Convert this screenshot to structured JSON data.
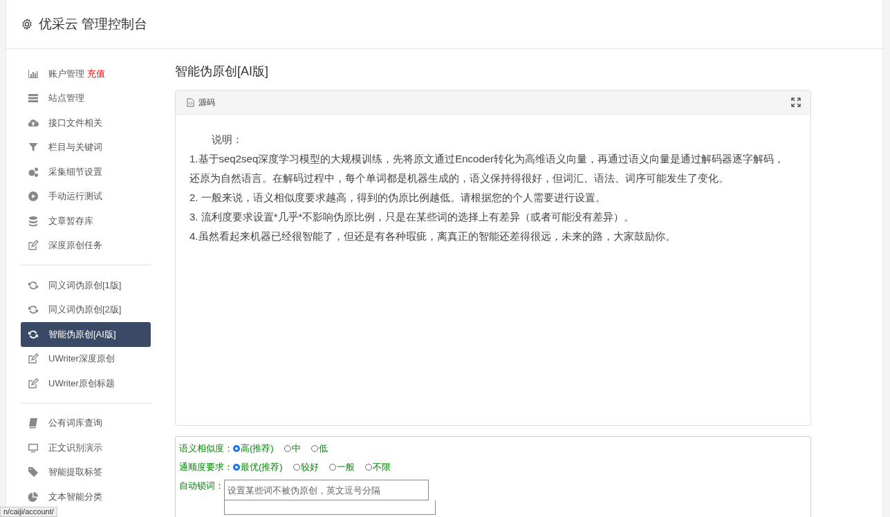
{
  "header": {
    "title": "优采云 管理控制台"
  },
  "sidebar": {
    "groups": [
      {
        "items": [
          {
            "label": "账户管理",
            "badge": "充值",
            "selected": false
          },
          {
            "label": "站点管理",
            "selected": false
          },
          {
            "label": "接口文件相关",
            "selected": false
          },
          {
            "label": "栏目与关键词",
            "selected": false
          },
          {
            "label": "采集细节设置",
            "selected": false
          },
          {
            "label": "手动运行测试",
            "selected": false
          },
          {
            "label": "文章暂存库",
            "selected": false
          },
          {
            "label": "深度原创任务",
            "selected": false
          }
        ]
      },
      {
        "items": [
          {
            "label": "同义词伪原创[1版]",
            "selected": false
          },
          {
            "label": "同义词伪原创[2版]",
            "selected": false
          },
          {
            "label": "智能伪原创[AI版]",
            "selected": true
          },
          {
            "label": "UWriter深度原创",
            "selected": false
          },
          {
            "label": "UWriter原创标题",
            "selected": false
          }
        ]
      },
      {
        "items": [
          {
            "label": "公有词库查询",
            "selected": false
          },
          {
            "label": "正文识别演示",
            "selected": false
          },
          {
            "label": "智能提取标签",
            "selected": false
          },
          {
            "label": "文本智能分类",
            "selected": false
          }
        ]
      }
    ]
  },
  "main": {
    "title": "智能伪原创[AI版]",
    "editor": {
      "tab": "源码",
      "lines": [
        "说明：",
        "1.基于seq2seq深度学习模型的大规模训练，先将原文通过Encoder转化为高维语义向量，再通过语义向量是通过解码器逐字解码，还原为自然语言。在解码过程中，每个单词都是机器生成的，语义保持得很好，但词汇、语法、词序可能发生了变化。",
        "2. 一般来说，语义相似度要求越高，得到的伪原比例越低。请根据您的个人需要进行设置。",
        "3. 流利度要求设置*几乎*不影响伪原比例，只是在某些词的选择上有差异（或者可能没有差异）。",
        "4.虽然看起来机器已经很智能了，但还是有各种瑕疵，离真正的智能还差得很远，未来的路，大家鼓励你。"
      ]
    },
    "options": [
      {
        "label": "语义相似度：",
        "choices": [
          {
            "label": "高(推荐)",
            "selected": true
          },
          {
            "label": "中",
            "selected": false
          },
          {
            "label": "低",
            "selected": false
          }
        ]
      },
      {
        "label": "通顺度要求：",
        "choices": [
          {
            "label": "最优(推荐)",
            "selected": true
          },
          {
            "label": "较好",
            "selected": false
          },
          {
            "label": "一般",
            "selected": false
          },
          {
            "label": "不限",
            "selected": false
          }
        ]
      }
    ],
    "lock_words": {
      "label": "自动锁词：",
      "placeholder": "设置某些词不被伪原创，英文逗号分隔"
    }
  },
  "status_bar": {
    "url": "n/caiji/account/"
  }
}
